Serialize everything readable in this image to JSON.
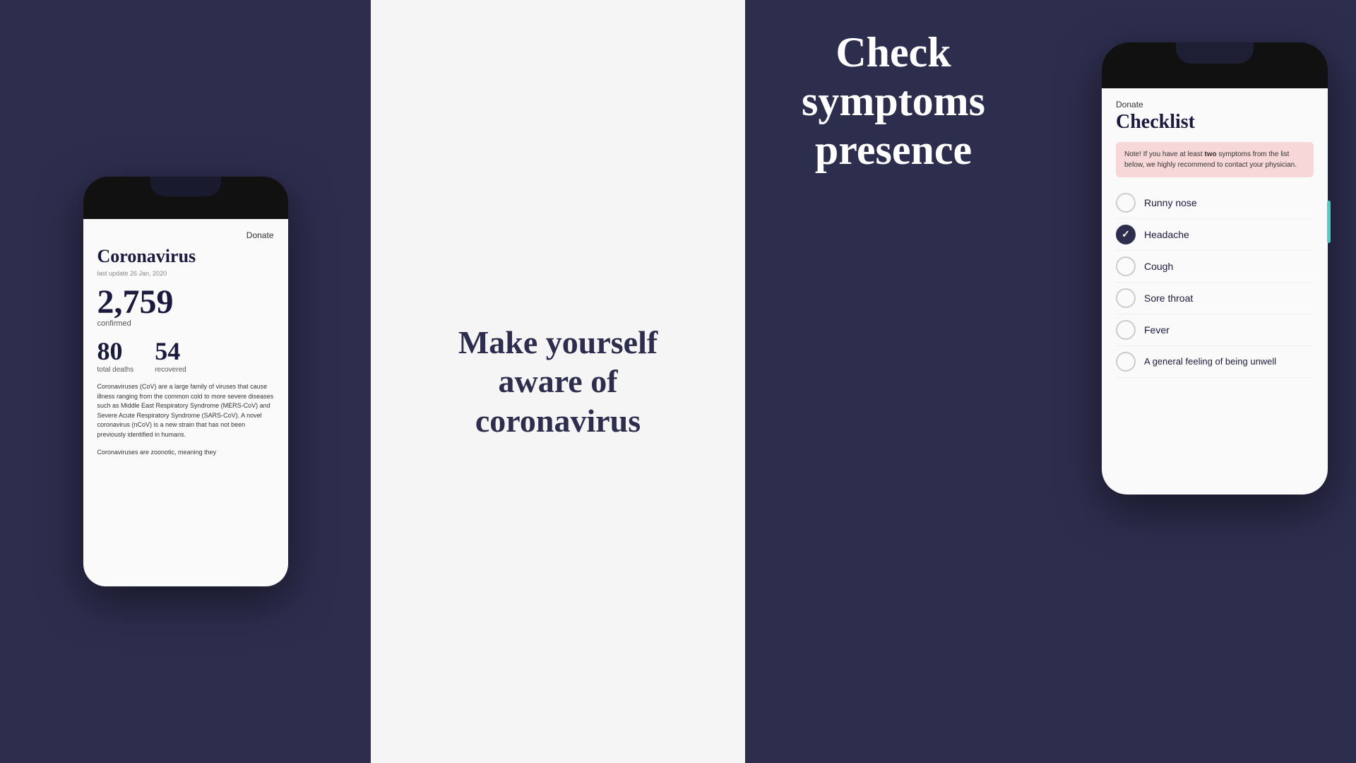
{
  "left_panel": {
    "bg_color": "#2d2d4e"
  },
  "phone_left": {
    "donate_label": "Donate",
    "title": "Coronavirus",
    "last_update": "last update 26 Jan, 2020",
    "confirmed_number": "2,759",
    "confirmed_label": "confirmed",
    "deaths_number": "80",
    "deaths_label": "total deaths",
    "recovered_number": "54",
    "recovered_label": "recovered",
    "description1": "Coronaviruses (CoV) are a large family of viruses that cause illness ranging from the common cold to more severe diseases such as Middle East Respiratory Syndrome (MERS-CoV) and Severe Acute Respiratory Syndrome (SARS-CoV). A novel coronavirus (nCoV) is a new strain that has not been previously identified in humans.",
    "description2": "Coronaviruses are zoonotic, meaning they"
  },
  "middle_panel": {
    "headline_line1": "Make yourself",
    "headline_line2": "aware of",
    "headline_line3": "coronavirus"
  },
  "right_panel": {
    "headline_line1": "Check",
    "headline_line2": "symptoms",
    "headline_line3": "presence"
  },
  "phone_right": {
    "donate_label": "Donate",
    "checklist_title": "Checklist",
    "note_text_prefix": "Note! If you have at least ",
    "note_text_bold": "two",
    "note_text_suffix": " symptoms from the list below, we highly recommend to contact your physician.",
    "items": [
      {
        "label": "Runny nose",
        "checked": false
      },
      {
        "label": "Headache",
        "checked": true
      },
      {
        "label": "Cough",
        "checked": false
      },
      {
        "label": "Sore throat",
        "checked": false
      },
      {
        "label": "Fever",
        "checked": false
      },
      {
        "label": "A general feeling of being unwell",
        "checked": false,
        "multiline": true
      }
    ]
  }
}
